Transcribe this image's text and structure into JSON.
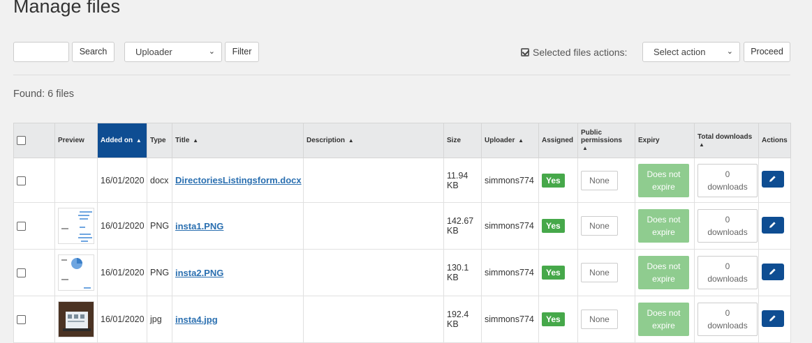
{
  "page": {
    "title": "Manage files"
  },
  "toolbar": {
    "search_button": "Search",
    "uploader_select": "Uploader",
    "filter_button": "Filter",
    "selected_actions_label": "Selected files actions:",
    "action_select": "Select action",
    "proceed_button": "Proceed"
  },
  "found": "Found: 6 files",
  "table": {
    "headers": {
      "preview": "Preview",
      "added_on": "Added on",
      "type": "Type",
      "title": "Title",
      "description": "Description",
      "size": "Size",
      "uploader": "Uploader",
      "assigned": "Assigned",
      "public_permissions": "Public permissions",
      "expiry": "Expiry",
      "total_downloads": "Total downloads",
      "actions": "Actions"
    },
    "rows": [
      {
        "date": "16/01/2020",
        "type": "docx",
        "title": "DirectoriesListingsform.docx",
        "size_num": "11.94",
        "size_unit": "KB",
        "uploader": "simmons774",
        "assigned": "Yes",
        "permissions": "None",
        "expiry_1": "Does not",
        "expiry_2": "expire",
        "dl_count": "0",
        "dl_label": "downloads"
      },
      {
        "date": "16/01/2020",
        "type": "PNG",
        "title": "insta1.PNG",
        "size_num": "142.67",
        "size_unit": "KB",
        "uploader": "simmons774",
        "assigned": "Yes",
        "permissions": "None",
        "expiry_1": "Does not",
        "expiry_2": "expire",
        "dl_count": "0",
        "dl_label": "downloads"
      },
      {
        "date": "16/01/2020",
        "type": "PNG",
        "title": "insta2.PNG",
        "size_num": "130.1",
        "size_unit": "KB",
        "uploader": "simmons774",
        "assigned": "Yes",
        "permissions": "None",
        "expiry_1": "Does not",
        "expiry_2": "expire",
        "dl_count": "0",
        "dl_label": "downloads"
      },
      {
        "date": "16/01/2020",
        "type": "jpg",
        "title": "insta4.jpg",
        "size_num": "192.4",
        "size_unit": "KB",
        "uploader": "simmons774",
        "assigned": "Yes",
        "permissions": "None",
        "expiry_1": "Does not",
        "expiry_2": "expire",
        "dl_count": "0",
        "dl_label": "downloads"
      }
    ]
  },
  "icons": {
    "edit": "pencil-icon",
    "sort": "sort-icon",
    "sort_asc": "sort-up-icon",
    "checkbox": "checkbox-icon",
    "check_square": "check-square-icon",
    "dropdown": "chevron-down-icon"
  },
  "colors": {
    "active_header": "#0e4d92",
    "assigned_badge": "#46a84a",
    "expiry_pill": "#8fcc8f",
    "edit_button": "#0e4d92",
    "link": "#2a6fb0"
  }
}
